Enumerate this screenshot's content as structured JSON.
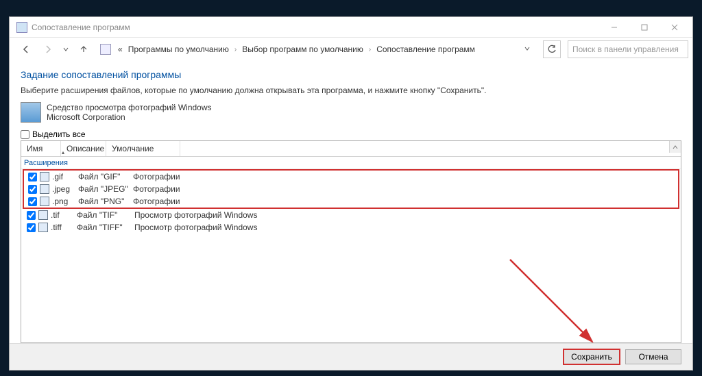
{
  "window": {
    "title": "Сопоставление программ"
  },
  "breadcrumb": {
    "root": "«",
    "items": [
      "Программы по умолчанию",
      "Выбор программ по умолчанию",
      "Сопоставление программ"
    ]
  },
  "search": {
    "placeholder": "Поиск в панели управления"
  },
  "page": {
    "title": "Задание сопоставлений программы",
    "instruction": "Выберите расширения файлов, которые по умолчанию должна открывать эта программа, и нажмите кнопку \"Сохранить\".",
    "program_name": "Средство просмотра фотографий Windows",
    "company": "Microsoft Corporation",
    "select_all": "Выделить все"
  },
  "columns": {
    "name": "Имя",
    "desc": "Описание",
    "default": "Умолчание"
  },
  "group_header": "Расширения",
  "rows": [
    {
      "checked": true,
      "ext": ".gif",
      "desc": "Файл \"GIF\"",
      "def": "Фотографии",
      "highlight": true
    },
    {
      "checked": true,
      "ext": ".jpeg",
      "desc": "Файл \"JPEG\"",
      "def": "Фотографии",
      "highlight": true
    },
    {
      "checked": true,
      "ext": ".png",
      "desc": "Файл \"PNG\"",
      "def": "Фотографии",
      "highlight": true
    },
    {
      "checked": true,
      "ext": ".tif",
      "desc": "Файл \"TIF\"",
      "def": "Просмотр фотографий Windows",
      "highlight": false
    },
    {
      "checked": true,
      "ext": ".tiff",
      "desc": "Файл \"TIFF\"",
      "def": "Просмотр фотографий Windows",
      "highlight": false
    }
  ],
  "buttons": {
    "save": "Сохранить",
    "cancel": "Отмена"
  }
}
